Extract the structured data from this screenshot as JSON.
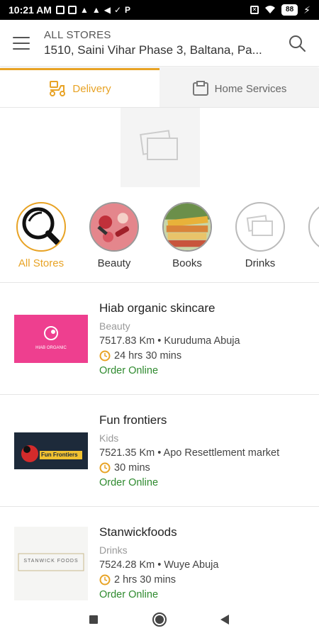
{
  "status_bar": {
    "time": "10:21 AM",
    "icons_left": [
      "sim-box-icon",
      "sim-box-icon",
      "warning-icon",
      "warning-icon",
      "megaphone-icon",
      "download-icon",
      "p-icon"
    ],
    "battery": "88"
  },
  "header": {
    "title": "ALL STORES",
    "address": "1510, Saini Vihar Phase 3, Baltana, Pa..."
  },
  "tabs": [
    {
      "label": "Delivery",
      "icon": "delivery-scooter-icon",
      "active": true
    },
    {
      "label": "Home Services",
      "icon": "home-services-icon",
      "active": false
    }
  ],
  "categories": [
    {
      "label": "All Stores",
      "icon": "magnifier-icon",
      "active": true
    },
    {
      "label": "Beauty",
      "icon": "beauty-image",
      "active": false
    },
    {
      "label": "Books",
      "icon": "books-image",
      "active": false
    },
    {
      "label": "Drinks",
      "icon": "placeholder-image-icon",
      "active": false
    }
  ],
  "stores": [
    {
      "name": "Hiab organic skincare",
      "category": "Beauty",
      "distance": "7517.83 Km • Kuruduma Abuja",
      "time": "24 hrs 30 mins",
      "order": "Order Online",
      "thumb_text": "HIAB ORGANIC"
    },
    {
      "name": "Fun frontiers",
      "category": "Kids",
      "distance": "7521.35 Km • Apo Resettlement market",
      "time": "30 mins",
      "order": "Order Online",
      "thumb_text": "Fun Frontiers"
    },
    {
      "name": "Stanwickfoods",
      "category": "Drinks",
      "distance": "7524.28 Km • Wuye Abuja",
      "time": "2 hrs 30 mins",
      "order": "Order Online",
      "thumb_text": "STANWICK FOODS"
    }
  ],
  "colors": {
    "accent": "#e8a325",
    "order_green": "#2e8a2e",
    "beauty_pink": "#ee3f8f"
  }
}
